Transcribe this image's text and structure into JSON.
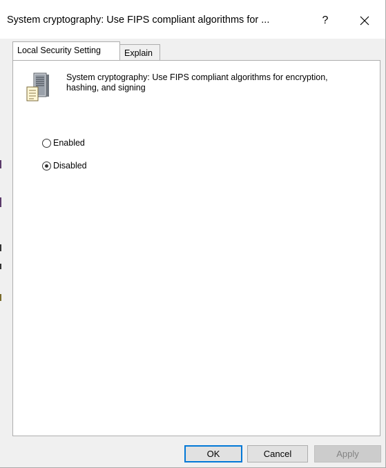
{
  "window": {
    "title": "System cryptography: Use FIPS compliant algorithms for ...",
    "help_glyph": "?",
    "close_glyph": "✕"
  },
  "tabs": [
    {
      "label": "Local Security Setting",
      "active": true
    },
    {
      "label": "Explain",
      "active": false
    }
  ],
  "policy": {
    "icon": "server-policy-icon",
    "description": "System cryptography: Use FIPS compliant algorithms for encryption, hashing, and signing"
  },
  "options": [
    {
      "label": "Enabled",
      "selected": false
    },
    {
      "label": "Disabled",
      "selected": true
    }
  ],
  "buttons": {
    "ok": "OK",
    "cancel": "Cancel",
    "apply": "Apply"
  },
  "colors": {
    "accent": "#0078d7",
    "dialog_bg": "#f0f0f0",
    "panel_bg": "#ffffff",
    "disabled_text": "#838383"
  }
}
